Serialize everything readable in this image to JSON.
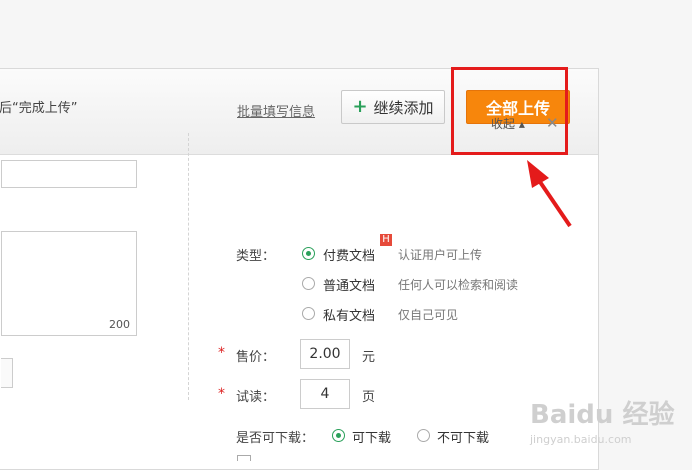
{
  "toolbar": {
    "hint": "后“完成上传”",
    "batch_fill": "批量填写信息",
    "continue_add": "继续添加",
    "upload_all": "全部上传"
  },
  "collapse": {
    "label": "收起 ▴"
  },
  "left": {
    "char_count": "200"
  },
  "form": {
    "type_label": "类型：",
    "types": [
      {
        "label": "付费文档",
        "desc": "认证用户可上传",
        "checked": true
      },
      {
        "label": "普通文档",
        "desc": "任何人可以检索和阅读",
        "checked": false
      },
      {
        "label": "私有文档",
        "desc": "仅自己可见",
        "checked": false
      }
    ],
    "badge": "H",
    "price_label": "售价：",
    "price_value": "2.00",
    "price_unit": "元",
    "trial_label": "试读：",
    "trial_value": "4",
    "trial_unit": "页",
    "download_label": "是否可下载：",
    "download_options": [
      {
        "label": "可下载",
        "checked": true
      },
      {
        "label": "不可下载",
        "checked": false
      }
    ],
    "required_mark": "*"
  },
  "annotation": {
    "color": "#e41b1b"
  },
  "colors": {
    "accent": "#f7860c",
    "radio": "#2aa05a"
  },
  "watermark": {
    "logo": "Baidu 经验",
    "sub": "jingyan.baidu.com"
  }
}
